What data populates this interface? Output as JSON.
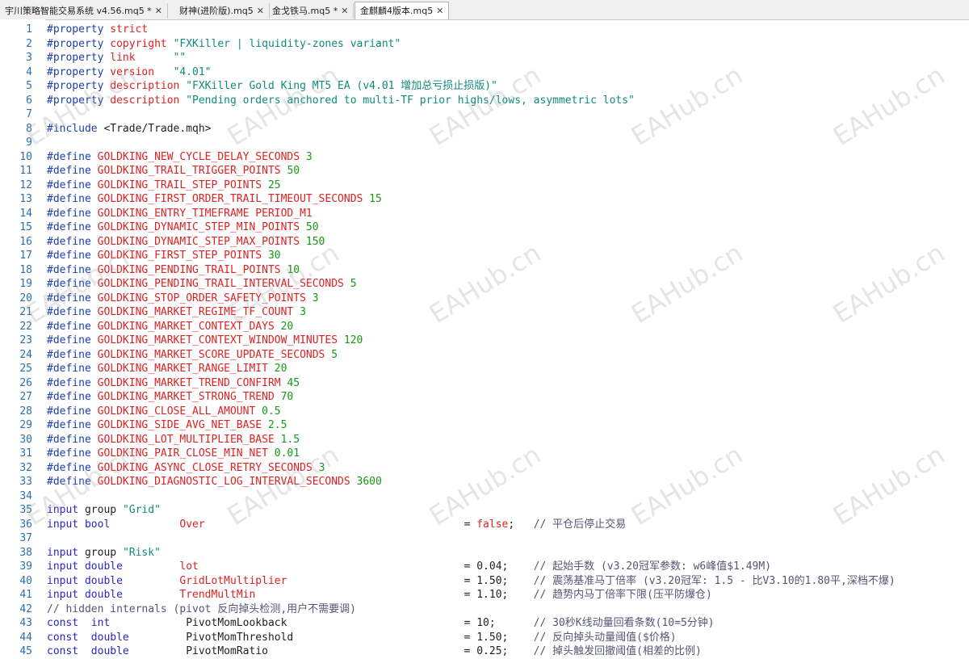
{
  "tabs": [
    {
      "label": "宇川策略智能交易系统 v4.56.mq5 *",
      "close": "✕",
      "active": false
    },
    {
      "label": "财神(进阶版).mq5",
      "close": "✕",
      "active": false
    },
    {
      "label": "金戈铁马.mq5 *",
      "close": "✕",
      "active": false
    },
    {
      "label": "金麒麟4版本.mq5",
      "close": "✕",
      "active": true
    }
  ],
  "watermark": "EAHub.cn",
  "colors": {
    "keyword": "#2727c9",
    "identifier": "#dd2222",
    "string": "#108a7b",
    "number": "#169916",
    "comment": "#555577",
    "line_number": "#2b6fb2"
  },
  "lines": [
    {
      "n": "1",
      "seg": [
        {
          "t": "kwpp",
          "v": "#property "
        },
        {
          "t": "id",
          "v": "strict"
        }
      ]
    },
    {
      "n": "2",
      "seg": [
        {
          "t": "kwpp",
          "v": "#property "
        },
        {
          "t": "id",
          "v": "copyright "
        },
        {
          "t": "str",
          "v": "\"FXKiller | liquidity-zones variant\""
        }
      ]
    },
    {
      "n": "3",
      "seg": [
        {
          "t": "kwpp",
          "v": "#property "
        },
        {
          "t": "id",
          "v": "link      "
        },
        {
          "t": "str",
          "v": "\"\""
        }
      ]
    },
    {
      "n": "4",
      "seg": [
        {
          "t": "kwpp",
          "v": "#property "
        },
        {
          "t": "id",
          "v": "version   "
        },
        {
          "t": "str",
          "v": "\"4.01\""
        }
      ]
    },
    {
      "n": "5",
      "seg": [
        {
          "t": "kwpp",
          "v": "#property "
        },
        {
          "t": "id",
          "v": "description "
        },
        {
          "t": "str",
          "v": "\"FXKiller Gold King MT5 EA (v4.01 增加总亏损止损版)\""
        }
      ]
    },
    {
      "n": "6",
      "seg": [
        {
          "t": "kwpp",
          "v": "#property "
        },
        {
          "t": "id",
          "v": "description "
        },
        {
          "t": "str",
          "v": "\"Pending orders anchored to multi-TF prior highs/lows, asymmetric lots\""
        }
      ]
    },
    {
      "n": "7",
      "seg": []
    },
    {
      "n": "8",
      "seg": [
        {
          "t": "kwpp",
          "v": "#include "
        },
        {
          "t": "pl",
          "v": "<Trade/Trade.mqh>"
        }
      ]
    },
    {
      "n": "9",
      "seg": []
    },
    {
      "n": "10",
      "seg": [
        {
          "t": "kwpp",
          "v": "#define "
        },
        {
          "t": "id",
          "v": "GOLDKING_NEW_CYCLE_DELAY_SECONDS "
        },
        {
          "t": "num",
          "v": "3"
        }
      ]
    },
    {
      "n": "11",
      "seg": [
        {
          "t": "kwpp",
          "v": "#define "
        },
        {
          "t": "id",
          "v": "GOLDKING_TRAIL_TRIGGER_POINTS "
        },
        {
          "t": "num",
          "v": "50"
        }
      ]
    },
    {
      "n": "12",
      "seg": [
        {
          "t": "kwpp",
          "v": "#define "
        },
        {
          "t": "id",
          "v": "GOLDKING_TRAIL_STEP_POINTS "
        },
        {
          "t": "num",
          "v": "25"
        }
      ]
    },
    {
      "n": "13",
      "seg": [
        {
          "t": "kwpp",
          "v": "#define "
        },
        {
          "t": "id",
          "v": "GOLDKING_FIRST_ORDER_TRAIL_TIMEOUT_SECONDS "
        },
        {
          "t": "num",
          "v": "15"
        }
      ]
    },
    {
      "n": "14",
      "seg": [
        {
          "t": "kwpp",
          "v": "#define "
        },
        {
          "t": "id",
          "v": "GOLDKING_ENTRY_TIMEFRAME PERIOD_M1"
        }
      ]
    },
    {
      "n": "15",
      "seg": [
        {
          "t": "kwpp",
          "v": "#define "
        },
        {
          "t": "id",
          "v": "GOLDKING_DYNAMIC_STEP_MIN_POINTS "
        },
        {
          "t": "num",
          "v": "50"
        }
      ]
    },
    {
      "n": "16",
      "seg": [
        {
          "t": "kwpp",
          "v": "#define "
        },
        {
          "t": "id",
          "v": "GOLDKING_DYNAMIC_STEP_MAX_POINTS "
        },
        {
          "t": "num",
          "v": "150"
        }
      ]
    },
    {
      "n": "17",
      "seg": [
        {
          "t": "kwpp",
          "v": "#define "
        },
        {
          "t": "id",
          "v": "GOLDKING_FIRST_STEP_POINTS "
        },
        {
          "t": "num",
          "v": "30"
        }
      ]
    },
    {
      "n": "18",
      "seg": [
        {
          "t": "kwpp",
          "v": "#define "
        },
        {
          "t": "id",
          "v": "GOLDKING_PENDING_TRAIL_POINTS "
        },
        {
          "t": "num",
          "v": "10"
        }
      ]
    },
    {
      "n": "19",
      "seg": [
        {
          "t": "kwpp",
          "v": "#define "
        },
        {
          "t": "id",
          "v": "GOLDKING_PENDING_TRAIL_INTERVAL_SECONDS "
        },
        {
          "t": "num",
          "v": "5"
        }
      ]
    },
    {
      "n": "20",
      "seg": [
        {
          "t": "kwpp",
          "v": "#define "
        },
        {
          "t": "id",
          "v": "GOLDKING_STOP_ORDER_SAFETY_POINTS "
        },
        {
          "t": "num",
          "v": "3"
        }
      ]
    },
    {
      "n": "21",
      "seg": [
        {
          "t": "kwpp",
          "v": "#define "
        },
        {
          "t": "id",
          "v": "GOLDKING_MARKET_REGIME_TF_COUNT "
        },
        {
          "t": "num",
          "v": "3"
        }
      ]
    },
    {
      "n": "22",
      "seg": [
        {
          "t": "kwpp",
          "v": "#define "
        },
        {
          "t": "id",
          "v": "GOLDKING_MARKET_CONTEXT_DAYS "
        },
        {
          "t": "num",
          "v": "20"
        }
      ]
    },
    {
      "n": "23",
      "seg": [
        {
          "t": "kwpp",
          "v": "#define "
        },
        {
          "t": "id",
          "v": "GOLDKING_MARKET_CONTEXT_WINDOW_MINUTES "
        },
        {
          "t": "num",
          "v": "120"
        }
      ]
    },
    {
      "n": "24",
      "seg": [
        {
          "t": "kwpp",
          "v": "#define "
        },
        {
          "t": "id",
          "v": "GOLDKING_MARKET_SCORE_UPDATE_SECONDS "
        },
        {
          "t": "num",
          "v": "5"
        }
      ]
    },
    {
      "n": "25",
      "seg": [
        {
          "t": "kwpp",
          "v": "#define "
        },
        {
          "t": "id",
          "v": "GOLDKING_MARKET_RANGE_LIMIT "
        },
        {
          "t": "num",
          "v": "20"
        }
      ]
    },
    {
      "n": "26",
      "seg": [
        {
          "t": "kwpp",
          "v": "#define "
        },
        {
          "t": "id",
          "v": "GOLDKING_MARKET_TREND_CONFIRM "
        },
        {
          "t": "num",
          "v": "45"
        }
      ]
    },
    {
      "n": "27",
      "seg": [
        {
          "t": "kwpp",
          "v": "#define "
        },
        {
          "t": "id",
          "v": "GOLDKING_MARKET_STRONG_TREND "
        },
        {
          "t": "num",
          "v": "70"
        }
      ]
    },
    {
      "n": "28",
      "seg": [
        {
          "t": "kwpp",
          "v": "#define "
        },
        {
          "t": "id",
          "v": "GOLDKING_CLOSE_ALL_AMOUNT "
        },
        {
          "t": "num",
          "v": "0.5"
        }
      ]
    },
    {
      "n": "29",
      "seg": [
        {
          "t": "kwpp",
          "v": "#define "
        },
        {
          "t": "id",
          "v": "GOLDKING_SIDE_AVG_NET_BASE "
        },
        {
          "t": "num",
          "v": "2.5"
        }
      ]
    },
    {
      "n": "30",
      "seg": [
        {
          "t": "kwpp",
          "v": "#define "
        },
        {
          "t": "id",
          "v": "GOLDKING_LOT_MULTIPLIER_BASE "
        },
        {
          "t": "num",
          "v": "1.5"
        }
      ]
    },
    {
      "n": "31",
      "seg": [
        {
          "t": "kwpp",
          "v": "#define "
        },
        {
          "t": "id",
          "v": "GOLDKING_PAIR_CLOSE_MIN_NET "
        },
        {
          "t": "num",
          "v": "0.01"
        }
      ]
    },
    {
      "n": "32",
      "seg": [
        {
          "t": "kwpp",
          "v": "#define "
        },
        {
          "t": "id",
          "v": "GOLDKING_ASYNC_CLOSE_RETRY_SECONDS "
        },
        {
          "t": "num",
          "v": "3"
        }
      ]
    },
    {
      "n": "33",
      "seg": [
        {
          "t": "kwpp",
          "v": "#define "
        },
        {
          "t": "id",
          "v": "GOLDKING_DIAGNOSTIC_LOG_INTERVAL_SECONDS "
        },
        {
          "t": "num",
          "v": "3600"
        }
      ]
    },
    {
      "n": "34",
      "seg": []
    },
    {
      "n": "35",
      "seg": [
        {
          "t": "kw",
          "v": "input "
        },
        {
          "t": "pl",
          "v": "group "
        },
        {
          "t": "str",
          "v": "\"Grid\""
        }
      ]
    },
    {
      "n": "36",
      "seg": [
        {
          "t": "kw",
          "v": "input "
        },
        {
          "t": "kw",
          "v": "bool           "
        },
        {
          "t": "id",
          "v": "Over                                         "
        },
        {
          "t": "op",
          "v": "= "
        },
        {
          "t": "id",
          "v": "false"
        },
        {
          "t": "op",
          "v": ";   "
        },
        {
          "t": "cm",
          "v": "// 平仓后停止交易"
        }
      ]
    },
    {
      "n": "37",
      "seg": []
    },
    {
      "n": "38",
      "seg": [
        {
          "t": "kw",
          "v": "input "
        },
        {
          "t": "pl",
          "v": "group "
        },
        {
          "t": "str",
          "v": "\"Risk\""
        }
      ]
    },
    {
      "n": "39",
      "seg": [
        {
          "t": "kw",
          "v": "input "
        },
        {
          "t": "kw",
          "v": "double         "
        },
        {
          "t": "id",
          "v": "lot                                          "
        },
        {
          "t": "op",
          "v": "= 0.04;    "
        },
        {
          "t": "cm",
          "v": "// 起始手数 (v3.20冠军参数: w6峰值$1.49M)"
        }
      ]
    },
    {
      "n": "40",
      "seg": [
        {
          "t": "kw",
          "v": "input "
        },
        {
          "t": "kw",
          "v": "double         "
        },
        {
          "t": "id",
          "v": "GridLotMultiplier                            "
        },
        {
          "t": "op",
          "v": "= 1.50;    "
        },
        {
          "t": "cm",
          "v": "// 震荡基准马丁倍率 (v3.20冠军: 1.5 - 比V3.10的1.80平,深档不爆)"
        }
      ]
    },
    {
      "n": "41",
      "seg": [
        {
          "t": "kw",
          "v": "input "
        },
        {
          "t": "kw",
          "v": "double         "
        },
        {
          "t": "id",
          "v": "TrendMultMin                                 "
        },
        {
          "t": "op",
          "v": "= 1.10;    "
        },
        {
          "t": "cm",
          "v": "// 趋势内马丁倍率下限(压平防爆仓)"
        }
      ]
    },
    {
      "n": "42",
      "seg": [
        {
          "t": "cm",
          "v": "// hidden internals (pivot 反向掉头检测,用户不需要调)"
        }
      ]
    },
    {
      "n": "43",
      "seg": [
        {
          "t": "kw",
          "v": "const  "
        },
        {
          "t": "kw",
          "v": "int            "
        },
        {
          "t": "pl",
          "v": "PivotMomLookback                            "
        },
        {
          "t": "op",
          "v": "= 10;      "
        },
        {
          "t": "cm",
          "v": "// 30秒K线动量回看条数(10=5分钟)"
        }
      ]
    },
    {
      "n": "44",
      "seg": [
        {
          "t": "kw",
          "v": "const  "
        },
        {
          "t": "kw",
          "v": "double         "
        },
        {
          "t": "pl",
          "v": "PivotMomThreshold                           "
        },
        {
          "t": "op",
          "v": "= 1.50;    "
        },
        {
          "t": "cm",
          "v": "// 反向掉头动量阈值($价格)"
        }
      ]
    },
    {
      "n": "45",
      "seg": [
        {
          "t": "kw",
          "v": "const  "
        },
        {
          "t": "kw",
          "v": "double         "
        },
        {
          "t": "pl",
          "v": "PivotMomRatio                               "
        },
        {
          "t": "op",
          "v": "= 0.25;    "
        },
        {
          "t": "cm",
          "v": "// 掉头触发回撤阈值(相差的比例)"
        }
      ]
    }
  ]
}
